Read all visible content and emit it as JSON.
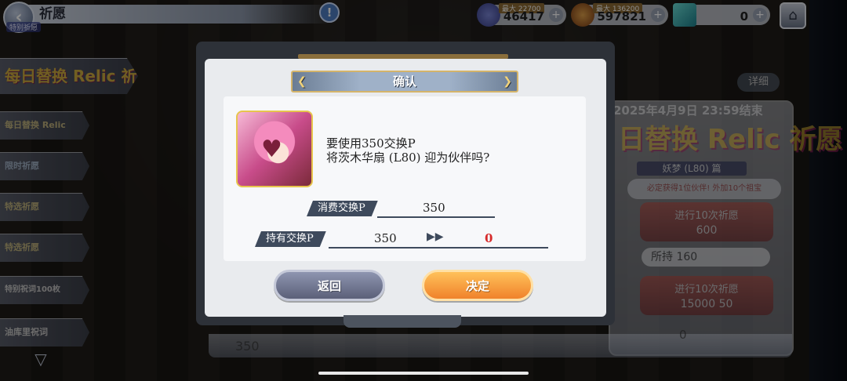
{
  "top": {
    "title": "祈愿",
    "subtitle": "特别祈愿",
    "currencies": [
      {
        "cap": "最大 22700",
        "value": "46417"
      },
      {
        "cap": "最大 136200",
        "value": "597821"
      },
      {
        "cap": "",
        "value": "0"
      }
    ]
  },
  "left_banners": [
    "每日替换 Relic 祈愿",
    "每日替换 Relic",
    "限时祈愿",
    "特选祈愿",
    "特选祈愿",
    "特别祝词100枚",
    "油库里祝词"
  ],
  "event": {
    "detail_label": "详细",
    "date": "2025年4月9日 23:59结束",
    "logo": "日替换 Relic 祈愿",
    "char_label": "妖梦 (L80) 篇",
    "note": "必定获得1位伙伴! 外加10个祖宝",
    "pull1_label": "进行10次祈愿",
    "pull1_cost": "600",
    "own_label": "所持",
    "own_value": "160",
    "pull2_label": "进行10次祈愿",
    "pull2_cost_a": "15000",
    "pull2_cost_b": "50",
    "bottom_left": "350",
    "bottom_right": "0"
  },
  "dialog": {
    "title": "确认",
    "message_line1": "要使用350交换P",
    "message_line2": "将茨木华扇 (L80) 迎为伙伴吗?",
    "cost_label": "消费交换P",
    "cost_value": "350",
    "held_label": "持有交换P",
    "held_before": "350",
    "arrow": "▶▶",
    "held_after": "0",
    "back_label": "返回",
    "ok_label": "决定"
  },
  "colors": {
    "ok_button": "#f0822b",
    "back_button": "#5b6079",
    "remaining_value": "#d62a2a"
  }
}
